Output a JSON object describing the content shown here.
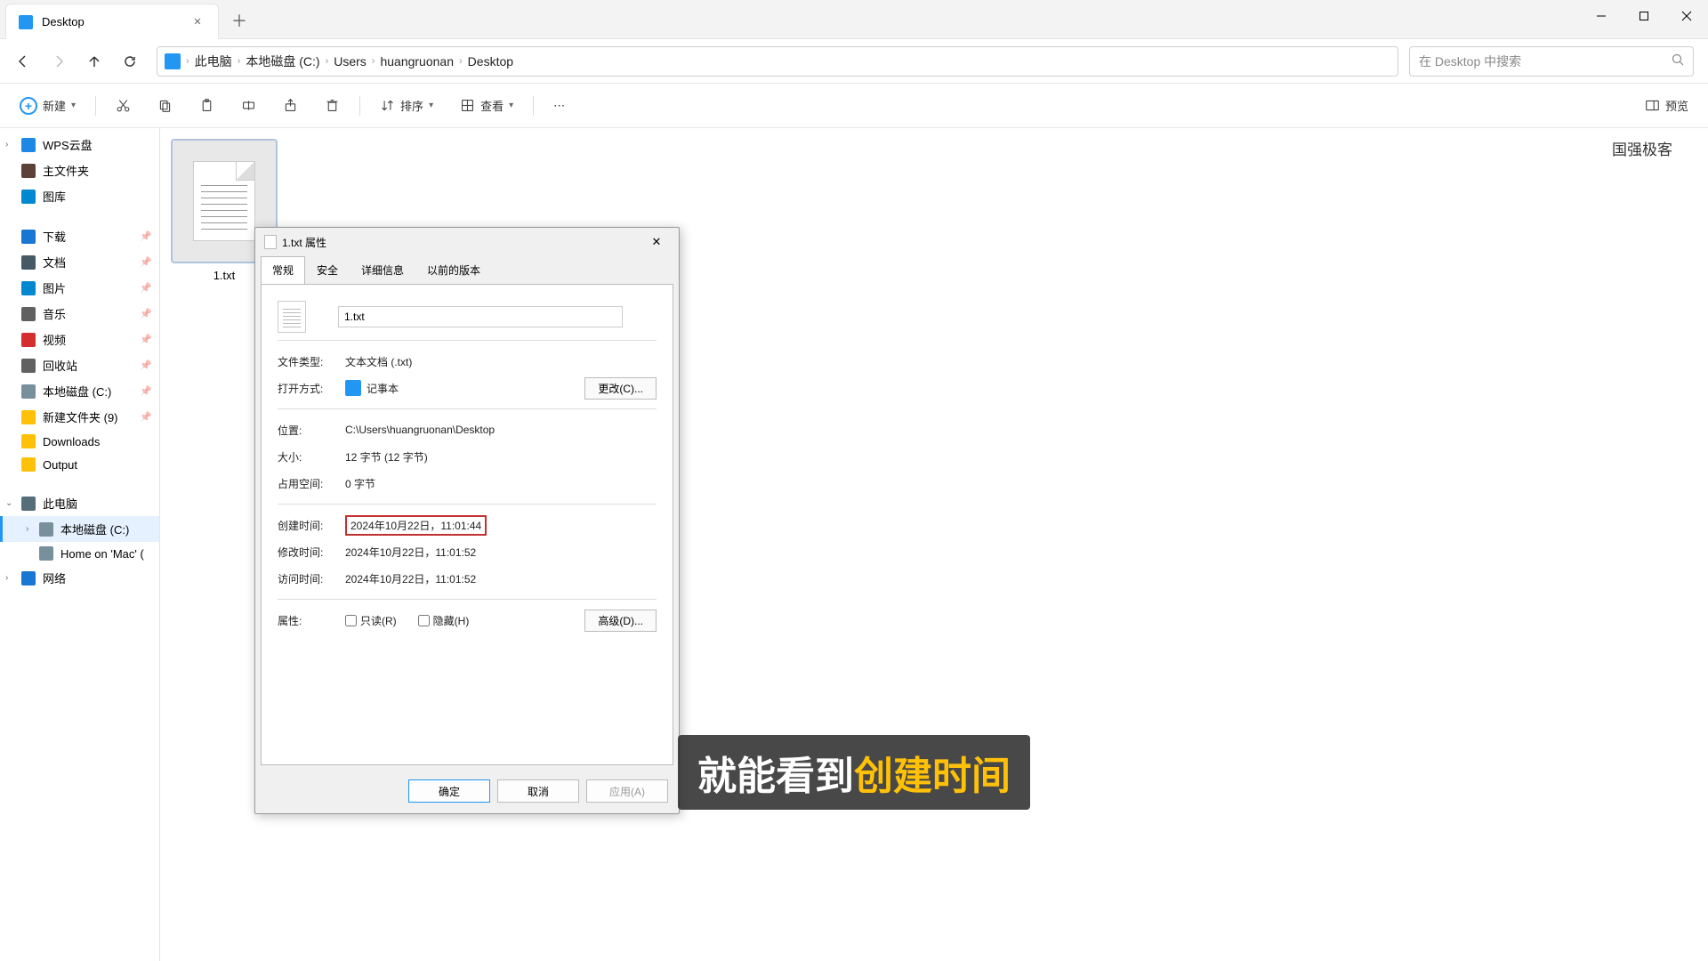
{
  "tab": {
    "title": "Desktop"
  },
  "breadcrumbs": [
    "此电脑",
    "本地磁盘 (C:)",
    "Users",
    "huangruonan",
    "Desktop"
  ],
  "search": {
    "placeholder": "在 Desktop 中搜索"
  },
  "toolbar": {
    "new": "新建",
    "sort": "排序",
    "view": "查看",
    "preview": "预览"
  },
  "sidebar": {
    "wps": "WPS云盘",
    "home": "主文件夹",
    "gallery": "图库",
    "downloads": "下载",
    "documents": "文档",
    "pictures": "图片",
    "music": "音乐",
    "videos": "视频",
    "recycle": "回收站",
    "localDisk": "本地磁盘 (C:)",
    "newFolder": "新建文件夹 (9)",
    "downloads2": "Downloads",
    "output": "Output",
    "thisPC": "此电脑",
    "localDisk2": "本地磁盘 (C:)",
    "homeMac": "Home on 'Mac' (",
    "network": "网络"
  },
  "file": {
    "name": "1.txt"
  },
  "watermark": "国强极客",
  "dialog": {
    "title": "1.txt 属性",
    "tabs": {
      "general": "常规",
      "security": "安全",
      "details": "详细信息",
      "prev": "以前的版本"
    },
    "filename": "1.txt",
    "typeLabel": "文件类型:",
    "typeValue": "文本文档 (.txt)",
    "openLabel": "打开方式:",
    "openApp": "记事本",
    "changeBtn": "更改(C)...",
    "locLabel": "位置:",
    "locValue": "C:\\Users\\huangruonan\\Desktop",
    "sizeLabel": "大小:",
    "sizeValue": "12 字节 (12 字节)",
    "diskLabel": "占用空间:",
    "diskValue": "0 字节",
    "createdLabel": "创建时间:",
    "createdValue": "2024年10月22日，11:01:44",
    "modifiedLabel": "修改时间:",
    "modifiedValue": "2024年10月22日，11:01:52",
    "accessedLabel": "访问时间:",
    "accessedValue": "2024年10月22日，11:01:52",
    "attrLabel": "属性:",
    "readonly": "只读(R)",
    "hidden": "隐藏(H)",
    "advanced": "高级(D)...",
    "ok": "确定",
    "cancel": "取消",
    "apply": "应用(A)"
  },
  "subtitle": {
    "plain": "就能看到",
    "accent": "创建时间"
  }
}
